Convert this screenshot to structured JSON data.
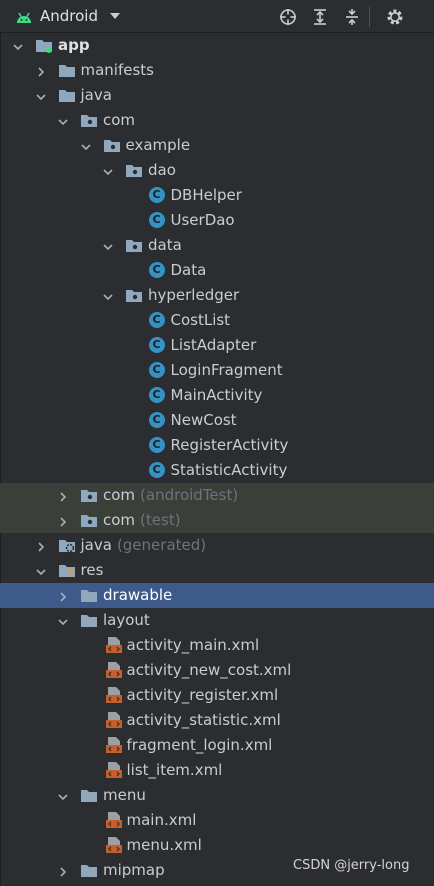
{
  "toolbar": {
    "view_label": "Android",
    "icons": [
      "android-icon",
      "crosshair-icon",
      "expand-all-icon",
      "collapse-all-icon",
      "gear-icon"
    ]
  },
  "tree": [
    {
      "label": "app",
      "sub": "",
      "icon": "module-folder",
      "expanded": true
    },
    {
      "label": "manifests",
      "sub": "",
      "icon": "folder",
      "expanded": false
    },
    {
      "label": "java",
      "sub": "",
      "icon": "folder",
      "expanded": true
    },
    {
      "label": "com",
      "sub": "",
      "icon": "package",
      "expanded": true
    },
    {
      "label": "example",
      "sub": "",
      "icon": "package",
      "expanded": true
    },
    {
      "label": "dao",
      "sub": "",
      "icon": "package",
      "expanded": true
    },
    {
      "label": "DBHelper",
      "sub": "",
      "icon": "class"
    },
    {
      "label": "UserDao",
      "sub": "",
      "icon": "class"
    },
    {
      "label": "data",
      "sub": "",
      "icon": "package",
      "expanded": true
    },
    {
      "label": "Data",
      "sub": "",
      "icon": "class"
    },
    {
      "label": "hyperledger",
      "sub": "",
      "icon": "package",
      "expanded": true
    },
    {
      "label": "CostList",
      "sub": "",
      "icon": "class"
    },
    {
      "label": "ListAdapter",
      "sub": "",
      "icon": "class"
    },
    {
      "label": "LoginFragment",
      "sub": "",
      "icon": "class"
    },
    {
      "label": "MainActivity",
      "sub": "",
      "icon": "class"
    },
    {
      "label": "NewCost",
      "sub": "",
      "icon": "class"
    },
    {
      "label": "RegisterActivity",
      "sub": "",
      "icon": "class"
    },
    {
      "label": "StatisticActivity",
      "sub": "",
      "icon": "class"
    },
    {
      "label": "com",
      "sub": "(androidTest)",
      "icon": "package",
      "expanded": false
    },
    {
      "label": "com",
      "sub": "(test)",
      "icon": "package",
      "expanded": false
    },
    {
      "label": "java",
      "sub": "(generated)",
      "icon": "generated-folder",
      "expanded": false
    },
    {
      "label": "res",
      "sub": "",
      "icon": "res-folder",
      "expanded": true
    },
    {
      "label": "drawable",
      "sub": "",
      "icon": "folder",
      "expanded": false
    },
    {
      "label": "layout",
      "sub": "",
      "icon": "folder",
      "expanded": true
    },
    {
      "label": "activity_main.xml",
      "sub": "",
      "icon": "xml"
    },
    {
      "label": "activity_new_cost.xml",
      "sub": "",
      "icon": "xml"
    },
    {
      "label": "activity_register.xml",
      "sub": "",
      "icon": "xml"
    },
    {
      "label": "activity_statistic.xml",
      "sub": "",
      "icon": "xml"
    },
    {
      "label": "fragment_login.xml",
      "sub": "",
      "icon": "xml"
    },
    {
      "label": "list_item.xml",
      "sub": "",
      "icon": "xml"
    },
    {
      "label": "menu",
      "sub": "",
      "icon": "folder",
      "expanded": true
    },
    {
      "label": "main.xml",
      "sub": "",
      "icon": "xml"
    },
    {
      "label": "menu.xml",
      "sub": "",
      "icon": "xml"
    },
    {
      "label": "mipmap",
      "sub": "",
      "icon": "folder",
      "expanded": false
    }
  ],
  "colors": {
    "background": "#2b2d30",
    "selection": "#3d5a8a",
    "test_highlight": "#3b3f39",
    "class_icon": "#3592c4",
    "xml_icon": "#c55f2b"
  },
  "watermark": "CSDN @jerry-long"
}
